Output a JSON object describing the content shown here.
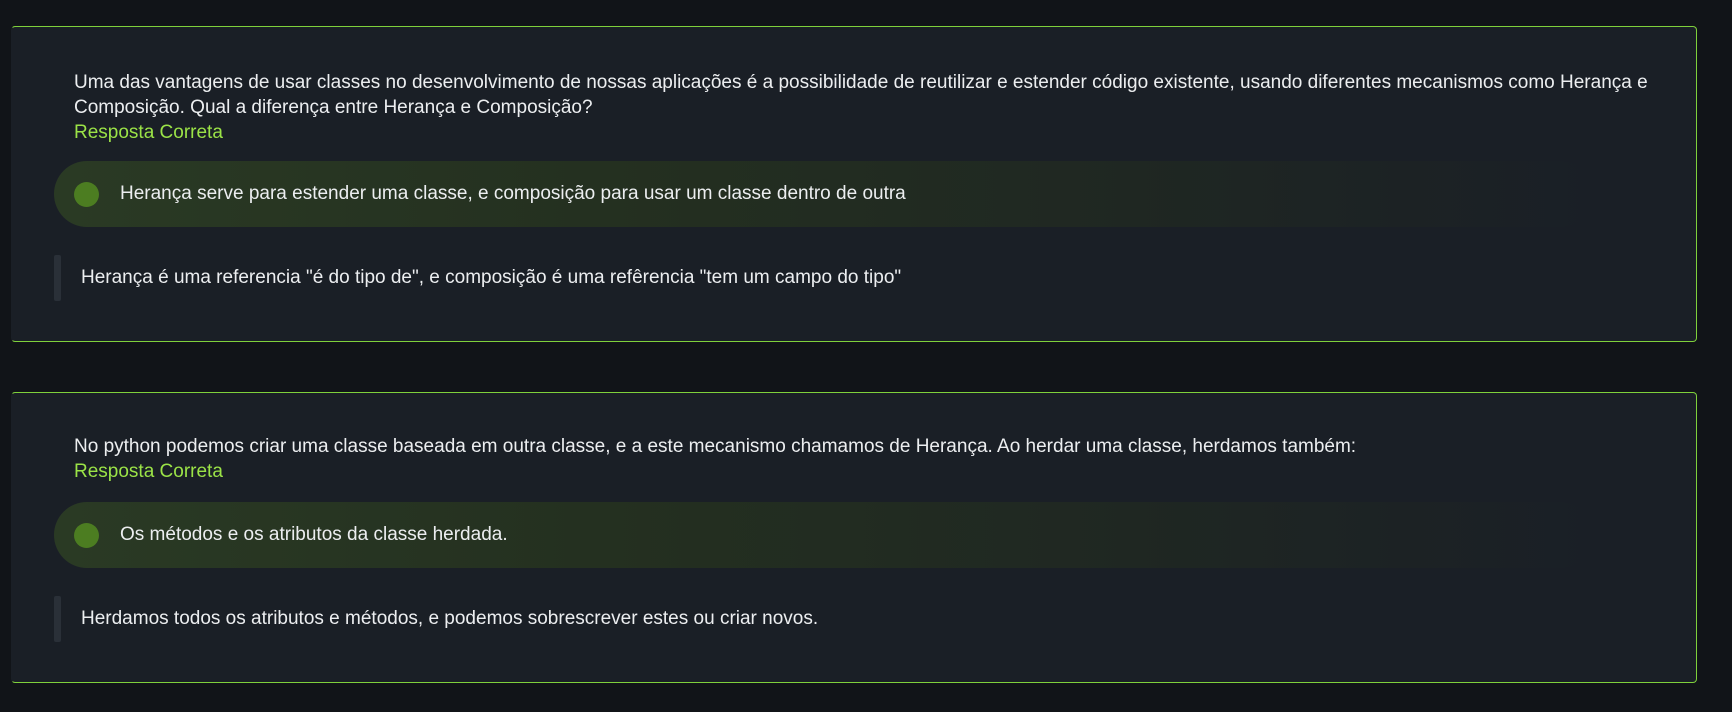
{
  "questions": [
    {
      "text": "Uma das vantagens de usar classes no desenvolvimento de nossas aplicações é a possibilidade de reutilizar e estender código existente, usando diferentes mecanismos como Herança e Composição. Qual a diferença entre Herança e Composição?",
      "verdict": "Resposta Correta",
      "answer": "Herança serve para estender uma classe, e composição para usar um classe dentro de outra",
      "feedback": "Herança é uma referencia \"é do tipo de\", e composição é uma refêrencia \"tem um campo do tipo\""
    },
    {
      "text": "No python podemos criar uma classe baseada em outra classe, e a este mecanismo chamamos de Herança. Ao herdar uma classe, herdamos também:",
      "verdict": "Resposta Correta",
      "answer": "Os métodos e os atributos da classe herdada.",
      "feedback": "Herdamos todos os atributos e métodos, e podemos sobrescrever estes ou criar novos."
    }
  ],
  "colors": {
    "background": "#111418",
    "card": "#1a1f26",
    "card_border": "#7fd13b",
    "correct_text": "#9be347",
    "radio_fill": "#4c7d21"
  }
}
